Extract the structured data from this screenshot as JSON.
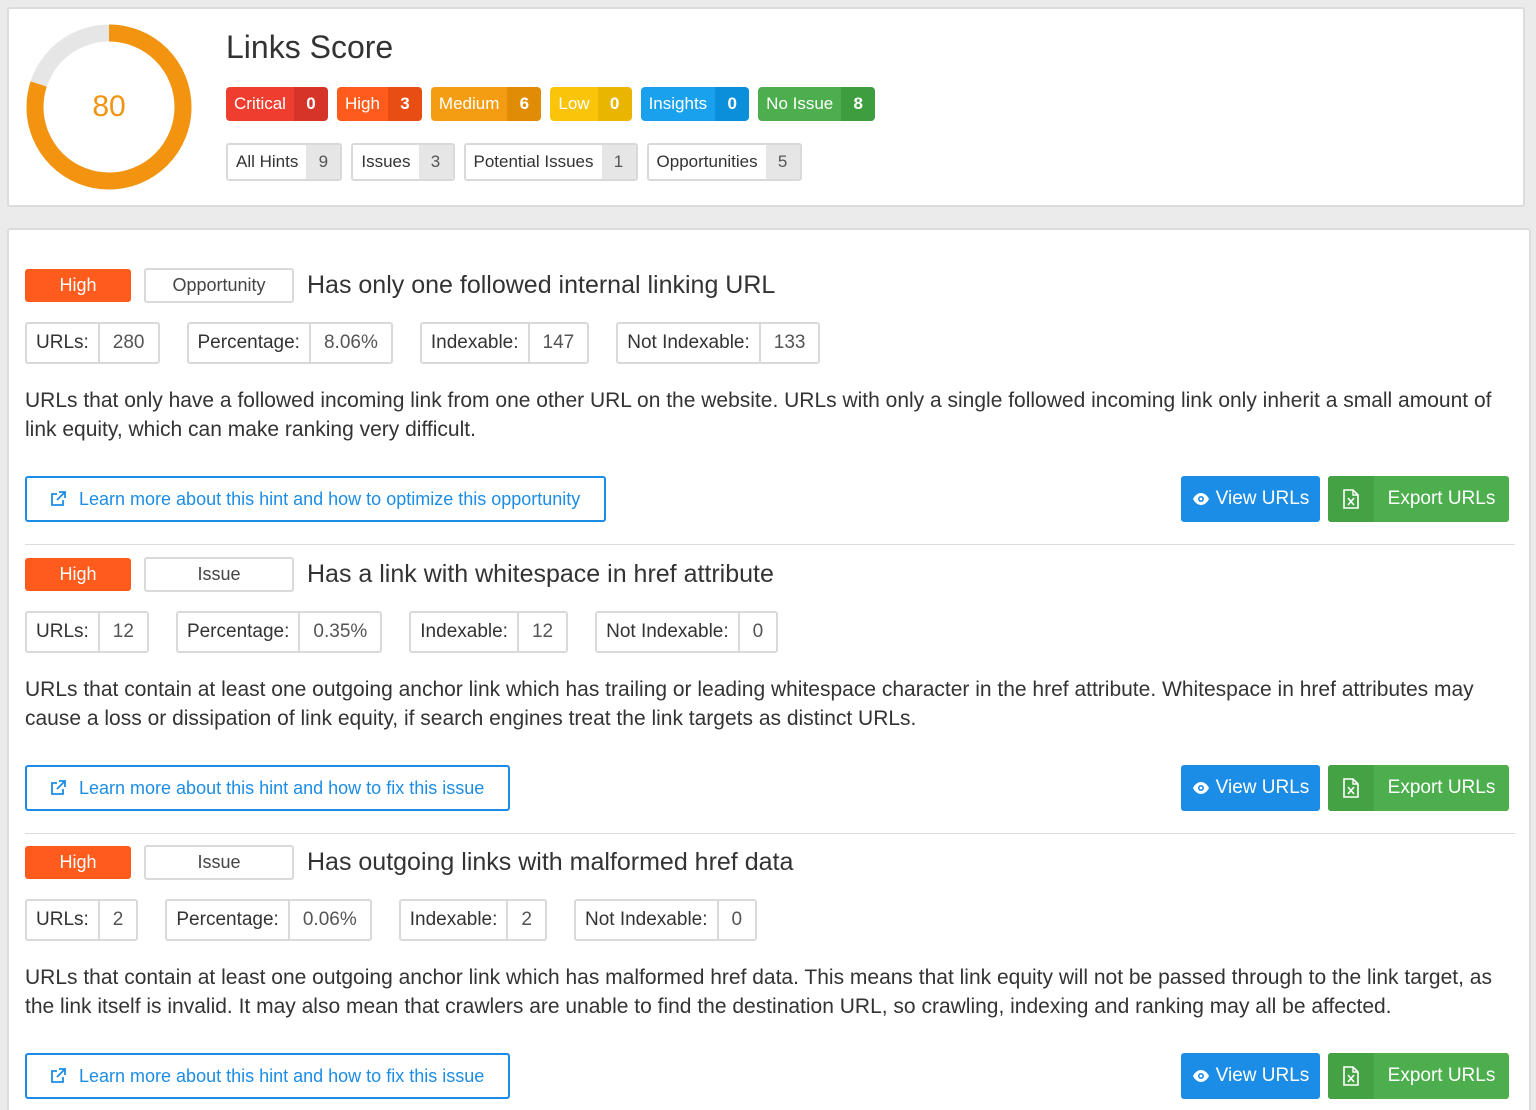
{
  "score": {
    "title": "Links Score",
    "value": "80",
    "ring_fraction": 0.8,
    "ring_color": "#f29410",
    "ring_track_color": "#e6e6e6"
  },
  "severity": [
    {
      "label": "Critical",
      "count": "0",
      "color": "#ef3e30",
      "count_color": "#d63428"
    },
    {
      "label": "High",
      "count": "3",
      "color": "#fe5b1d",
      "count_color": "#e84e13"
    },
    {
      "label": "Medium",
      "count": "6",
      "color": "#f49c12",
      "count_color": "#e08c06"
    },
    {
      "label": "Low",
      "count": "0",
      "color": "#f9c40a",
      "count_color": "#eab500"
    },
    {
      "label": "Insights",
      "count": "0",
      "color": "#1aa1ee",
      "count_color": "#0c8fdb"
    },
    {
      "label": "No Issue",
      "count": "8",
      "color": "#4dae4d",
      "count_color": "#3e9e3e"
    }
  ],
  "filters": [
    {
      "label": "All Hints",
      "count": "9"
    },
    {
      "label": "Issues",
      "count": "3"
    },
    {
      "label": "Potential Issues",
      "count": "1"
    },
    {
      "label": "Opportunities",
      "count": "5"
    }
  ],
  "stat_labels": {
    "urls": "URLs:",
    "percentage": "Percentage:",
    "indexable": "Indexable:",
    "not_indexable": "Not Indexable:"
  },
  "buttons": {
    "view": "View URLs",
    "export": "Export URLs"
  },
  "hints": [
    {
      "priority": "High",
      "type": "Opportunity",
      "title": "Has only one followed internal linking URL",
      "urls": "280",
      "percentage": "8.06%",
      "indexable": "147",
      "not_indexable": "133",
      "description": "URLs that only have a followed incoming link from one other URL on the website. URLs with only a single followed incoming link only inherit a small amount of link equity, which can make ranking very difficult.",
      "learn_more": "Learn more about this hint and how to optimize this opportunity"
    },
    {
      "priority": "High",
      "type": "Issue",
      "title": "Has a link with whitespace in href attribute",
      "urls": "12",
      "percentage": "0.35%",
      "indexable": "12",
      "not_indexable": "0",
      "description": "URLs that contain at least one outgoing anchor link which has trailing or leading whitespace character in the href attribute. Whitespace in href attributes may cause a loss or dissipation of link equity, if search engines treat the link targets as distinct URLs.",
      "learn_more": "Learn more about this hint and how to fix this issue"
    },
    {
      "priority": "High",
      "type": "Issue",
      "title": "Has outgoing links with malformed href data",
      "urls": "2",
      "percentage": "0.06%",
      "indexable": "2",
      "not_indexable": "0",
      "description": "URLs that contain at least one outgoing anchor link which has malformed href data. This means that link equity will not be passed through to the link target, as the link itself is invalid. It may also mean that crawlers are unable to find the destination URL, so crawling, indexing and ranking may all be affected.",
      "learn_more": "Learn more about this hint and how to fix this issue"
    }
  ]
}
